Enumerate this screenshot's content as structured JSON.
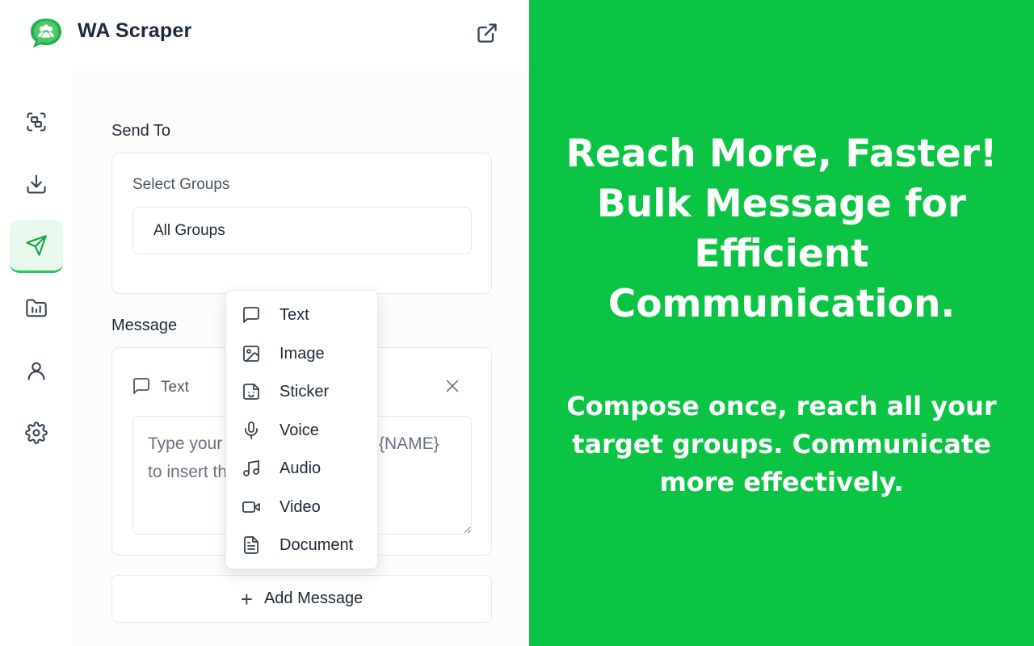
{
  "app": {
    "title": "WA Scraper"
  },
  "main": {
    "send_to_label": "Send To",
    "select_groups_label": "Select Groups",
    "select_groups_value": "All Groups",
    "message_label": "Message",
    "message_card": {
      "type_label": "Text",
      "placeholder": "Type your message here. Use {NAME} to insert the group name."
    },
    "add_message_label": "Add Message"
  },
  "dropdown": {
    "items": [
      {
        "label": "Text",
        "icon": "message-square-icon"
      },
      {
        "label": "Image",
        "icon": "image-icon"
      },
      {
        "label": "Sticker",
        "icon": "sticker-icon"
      },
      {
        "label": "Voice",
        "icon": "microphone-icon"
      },
      {
        "label": "Audio",
        "icon": "music-icon"
      },
      {
        "label": "Video",
        "icon": "video-icon"
      },
      {
        "label": "Document",
        "icon": "document-icon"
      }
    ]
  },
  "promo": {
    "headline": "Reach More, Faster! Bulk Message for Efficient Communication.",
    "subtext": "Compose once, reach all your target groups. Communicate more effectively."
  },
  "colors": {
    "brand_green": "#0bc444",
    "active_nav_bg": "#e9f8ed",
    "active_accent": "#22c55e"
  }
}
